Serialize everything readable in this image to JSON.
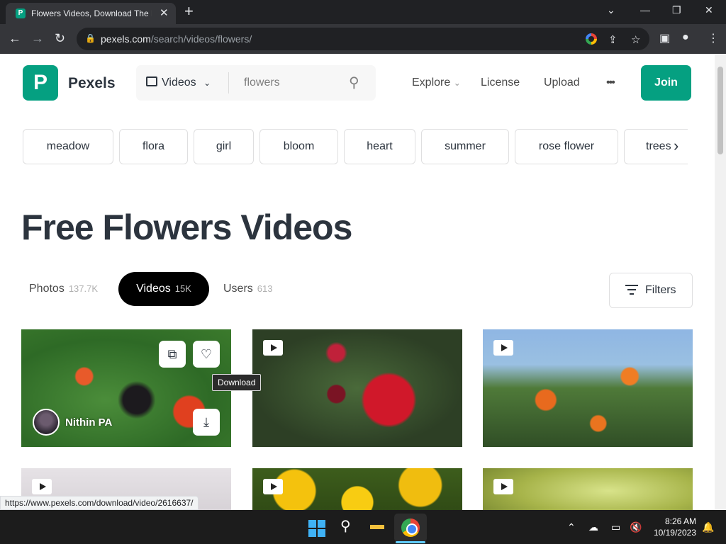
{
  "browser": {
    "tab_title": "Flowers Videos, Download The B",
    "tab_icon": "P",
    "tab_close": "✕",
    "new_tab": "+",
    "url_host": "pexels.com",
    "url_path": "/search/videos/flowers/"
  },
  "header": {
    "logo_letter": "P",
    "brand": "Pexels",
    "media_select": "Videos",
    "search_query": "flowers",
    "nav": [
      "Explore",
      "License",
      "Upload",
      "•••"
    ],
    "join": "Join"
  },
  "chips": [
    "meadow",
    "flora",
    "girl",
    "bloom",
    "heart",
    "summer",
    "rose flower",
    "trees"
  ],
  "page_title": "Free Flowers Videos",
  "tabs": [
    {
      "label": "Photos",
      "count": "137.7K"
    },
    {
      "label": "Videos",
      "count": "15K"
    },
    {
      "label": "Users",
      "count": "613"
    }
  ],
  "filters_label": "Filters",
  "first_card": {
    "author": "Nithin PA"
  },
  "tooltip": "Download",
  "status_url": "https://www.pexels.com/download/video/2616637/",
  "clock": {
    "time": "8:26 AM",
    "date": "10/19/2023"
  },
  "colors": {
    "brand": "#05a081",
    "text": "#2c343e",
    "active_tab": "#000000"
  }
}
